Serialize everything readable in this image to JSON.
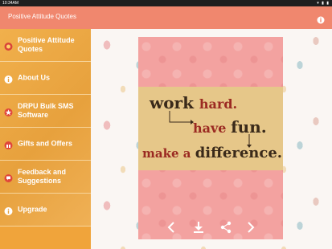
{
  "statusbar": {
    "time": "10:34AM",
    "system_icons": "▾ ▮ ▮"
  },
  "appbar": {
    "title": "Positive Attitude Quotes",
    "info_icon": "info-icon"
  },
  "drawer": {
    "items": [
      {
        "label": "Positive Attitude Quotes",
        "icon": "app-logo-icon"
      },
      {
        "label": "About Us",
        "icon": "info-icon"
      },
      {
        "label": "DRPU Bulk SMS Software",
        "icon": "star-icon"
      },
      {
        "label": "Gifts and Offers",
        "icon": "gift-icon"
      },
      {
        "label": "Feedback and Suggestions",
        "icon": "feedback-icon"
      },
      {
        "label": "Upgrade",
        "icon": "info-icon"
      }
    ]
  },
  "quote": {
    "line1_a": "work",
    "line1_b": "hard.",
    "line2_a": "have",
    "line2_b": "fun.",
    "line3_a": "make a",
    "line3_b": "difference."
  },
  "card_nav": {
    "prev_icon": "chevron-left-icon",
    "download_icon": "download-icon",
    "share_icon": "share-icon",
    "next_icon": "chevron-right-icon"
  },
  "colors": {
    "appbar": "#f0876e",
    "drawer": "#e9a440",
    "card": "#f3a2a0",
    "quote_band": "#e6c789",
    "quote_dark": "#3a2a1a",
    "quote_red": "#9b2a22"
  }
}
